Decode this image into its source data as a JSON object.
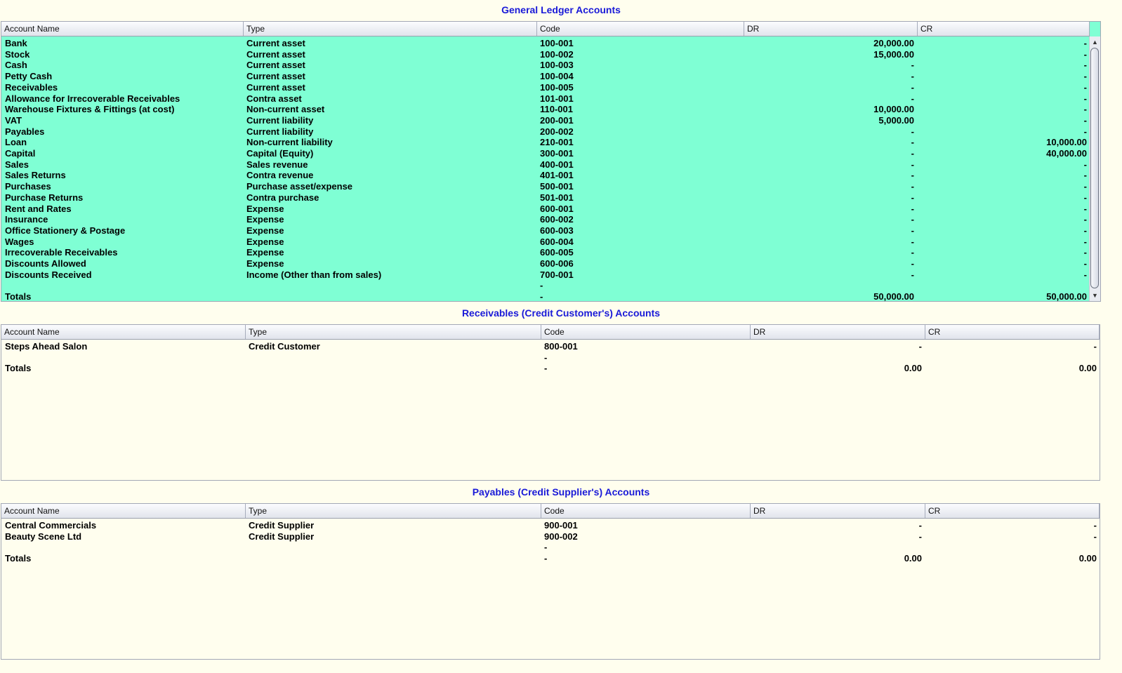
{
  "columns": [
    "Account Name",
    "Type",
    "Code",
    "DR",
    "CR"
  ],
  "general_ledger": {
    "title": "General Ledger Accounts",
    "rows": [
      {
        "name": "Bank",
        "type": "Current asset",
        "code": "100-001",
        "dr": "20,000.00",
        "cr": "-"
      },
      {
        "name": "Stock",
        "type": "Current asset",
        "code": "100-002",
        "dr": "15,000.00",
        "cr": "-"
      },
      {
        "name": "Cash",
        "type": "Current asset",
        "code": "100-003",
        "dr": "-",
        "cr": "-"
      },
      {
        "name": "Petty Cash",
        "type": "Current asset",
        "code": "100-004",
        "dr": "-",
        "cr": "-"
      },
      {
        "name": "Receivables",
        "type": "Current asset",
        "code": "100-005",
        "dr": "-",
        "cr": "-"
      },
      {
        "name": "Allowance for Irrecoverable Receivables",
        "type": "Contra asset",
        "code": "101-001",
        "dr": "-",
        "cr": "-"
      },
      {
        "name": "Warehouse Fixtures & Fittings (at cost)",
        "type": "Non-current asset",
        "code": "110-001",
        "dr": "10,000.00",
        "cr": "-"
      },
      {
        "name": "VAT",
        "type": "Current liability",
        "code": "200-001",
        "dr": "5,000.00",
        "cr": "-"
      },
      {
        "name": "Payables",
        "type": "Current liability",
        "code": "200-002",
        "dr": "-",
        "cr": "-"
      },
      {
        "name": "Loan",
        "type": "Non-current liability",
        "code": "210-001",
        "dr": "-",
        "cr": "10,000.00"
      },
      {
        "name": "Capital",
        "type": "Capital (Equity)",
        "code": "300-001",
        "dr": "-",
        "cr": "40,000.00"
      },
      {
        "name": "Sales",
        "type": "Sales revenue",
        "code": "400-001",
        "dr": "-",
        "cr": "-"
      },
      {
        "name": "Sales Returns",
        "type": "Contra revenue",
        "code": "401-001",
        "dr": "-",
        "cr": "-"
      },
      {
        "name": "Purchases",
        "type": "Purchase asset/expense",
        "code": "500-001",
        "dr": "-",
        "cr": "-"
      },
      {
        "name": "Purchase Returns",
        "type": "Contra purchase",
        "code": "501-001",
        "dr": "-",
        "cr": "-"
      },
      {
        "name": "Rent and Rates",
        "type": "Expense",
        "code": "600-001",
        "dr": "-",
        "cr": "-"
      },
      {
        "name": "Insurance",
        "type": "Expense",
        "code": "600-002",
        "dr": "-",
        "cr": "-"
      },
      {
        "name": "Office Stationery & Postage",
        "type": "Expense",
        "code": "600-003",
        "dr": "-",
        "cr": "-"
      },
      {
        "name": "Wages",
        "type": "Expense",
        "code": "600-004",
        "dr": "-",
        "cr": "-"
      },
      {
        "name": "Irrecoverable Receivables",
        "type": "Expense",
        "code": "600-005",
        "dr": "-",
        "cr": "-"
      },
      {
        "name": "Discounts Allowed",
        "type": "Expense",
        "code": "600-006",
        "dr": "-",
        "cr": "-"
      },
      {
        "name": "Discounts Received",
        "type": "Income (Other than from sales)",
        "code": "700-001",
        "dr": "-",
        "cr": "-"
      },
      {
        "name": "",
        "type": "",
        "code": "-",
        "dr": "",
        "cr": ""
      },
      {
        "name": "Totals",
        "type": "",
        "code": "-",
        "dr": "50,000.00",
        "cr": "50,000.00"
      }
    ]
  },
  "receivables": {
    "title": "Receivables (Credit Customer's) Accounts",
    "rows": [
      {
        "name": "Steps Ahead Salon",
        "type": "Credit Customer",
        "code": "800-001",
        "dr": "-",
        "cr": "-"
      },
      {
        "name": "",
        "type": "",
        "code": "-",
        "dr": "",
        "cr": ""
      },
      {
        "name": "Totals",
        "type": "",
        "code": "-",
        "dr": "0.00",
        "cr": "0.00"
      }
    ]
  },
  "payables": {
    "title": "Payables (Credit Supplier's) Accounts",
    "rows": [
      {
        "name": "Central Commercials",
        "type": "Credit Supplier",
        "code": "900-001",
        "dr": "-",
        "cr": "-"
      },
      {
        "name": "Beauty Scene Ltd",
        "type": "Credit Supplier",
        "code": "900-002",
        "dr": "-",
        "cr": "-"
      },
      {
        "name": "",
        "type": "",
        "code": "-",
        "dr": "",
        "cr": ""
      },
      {
        "name": "Totals",
        "type": "",
        "code": "-",
        "dr": "0.00",
        "cr": "0.00"
      }
    ]
  },
  "colors": {
    "general_ledger_bg": "#7fffd4",
    "subledger_bg": "#fffeee",
    "title_text": "#1919d8"
  },
  "icons": {
    "scroll_up": "▲",
    "scroll_down": "▼"
  }
}
